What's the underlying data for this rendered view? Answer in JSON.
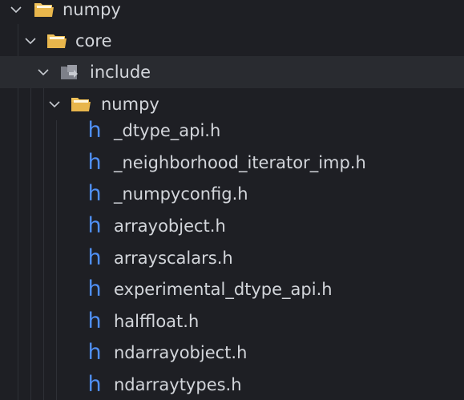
{
  "tree": {
    "items": [
      {
        "label": "numpy",
        "kind": "folder",
        "expanded": true,
        "icon": "folder-open-icon"
      },
      {
        "label": "core",
        "kind": "folder",
        "expanded": true,
        "icon": "folder-open-icon"
      },
      {
        "label": "include",
        "kind": "folder",
        "expanded": true,
        "icon": "include-folder-icon",
        "selected": true
      },
      {
        "label": "numpy",
        "kind": "folder",
        "expanded": true,
        "icon": "folder-open-icon"
      },
      {
        "label": "_dtype_api.h",
        "kind": "file",
        "icon": "h-file-icon"
      },
      {
        "label": "_neighborhood_iterator_imp.h",
        "kind": "file",
        "icon": "h-file-icon"
      },
      {
        "label": "_numpyconfig.h",
        "kind": "file",
        "icon": "h-file-icon"
      },
      {
        "label": "arrayobject.h",
        "kind": "file",
        "icon": "h-file-icon"
      },
      {
        "label": "arrayscalars.h",
        "kind": "file",
        "icon": "h-file-icon"
      },
      {
        "label": "experimental_dtype_api.h",
        "kind": "file",
        "icon": "h-file-icon"
      },
      {
        "label": "halffloat.h",
        "kind": "file",
        "icon": "h-file-icon"
      },
      {
        "label": "ndarrayobject.h",
        "kind": "file",
        "icon": "h-file-icon"
      },
      {
        "label": "ndarraytypes.h",
        "kind": "file",
        "icon": "h-file-icon"
      }
    ],
    "h_glyph": "h"
  },
  "colors": {
    "background": "#1e1f24",
    "selected_row": "#292b30",
    "folder": "#e8b64c",
    "h_icon": "#4f8ff5",
    "text": "#d3d6db"
  }
}
